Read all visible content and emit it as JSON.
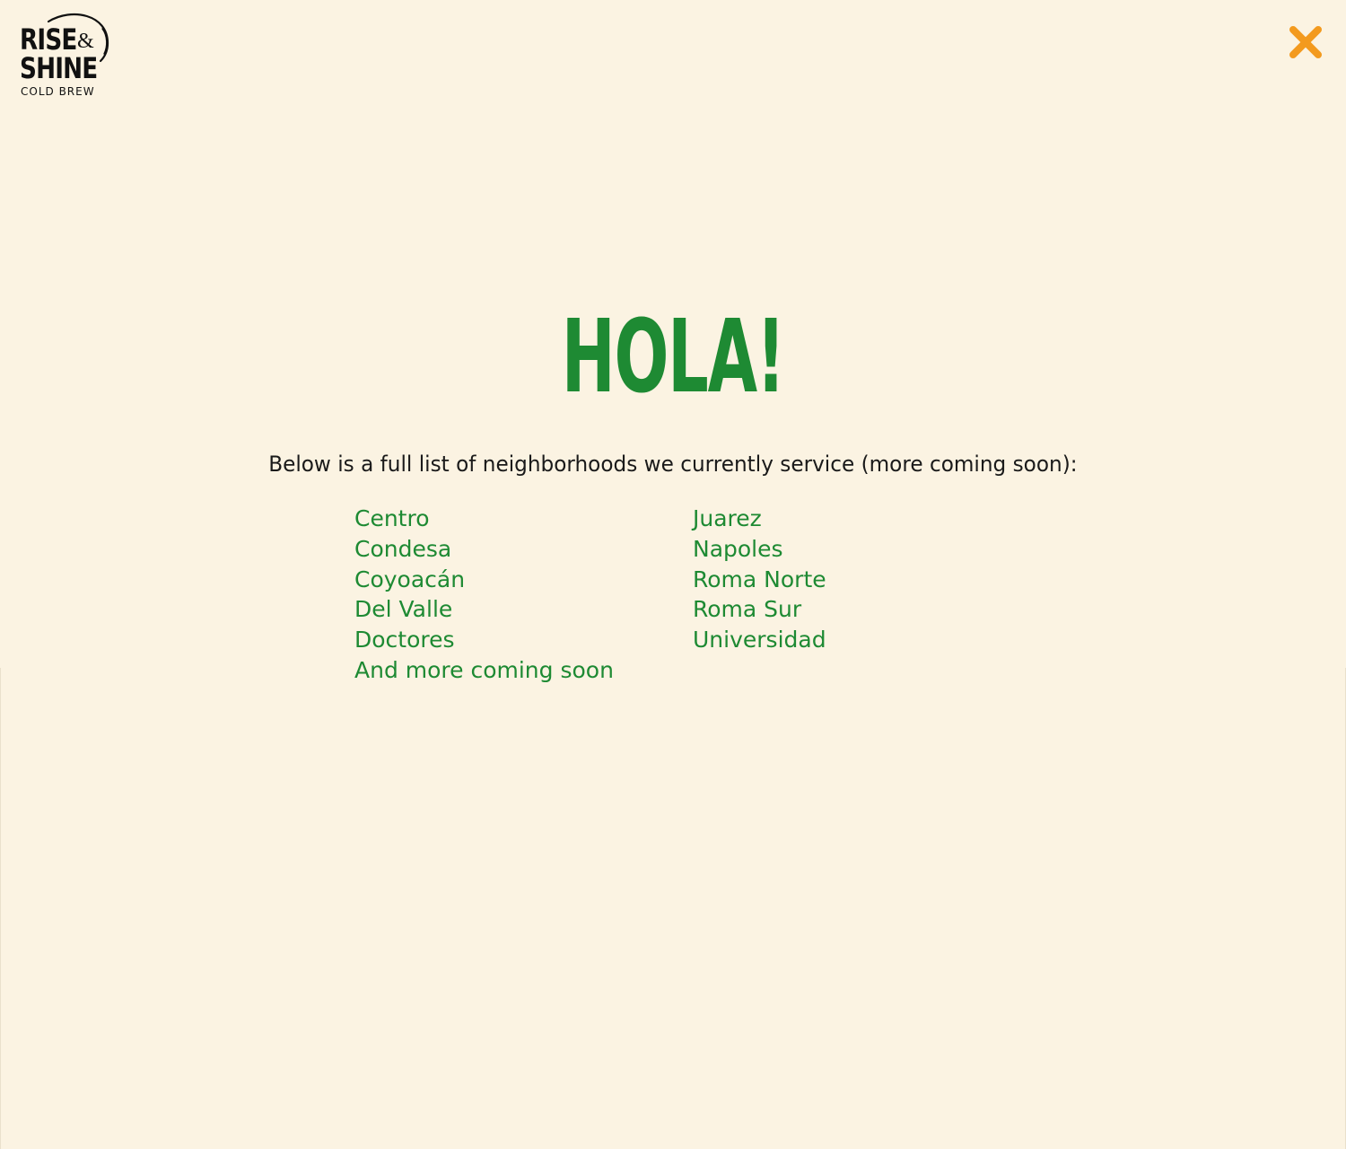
{
  "brand": {
    "line1": "RISE",
    "amp": "&",
    "line2": "SHINE",
    "tagline": "COLD BREW"
  },
  "close_button": {
    "icon": "close-icon",
    "color": "#F39A1E"
  },
  "modal": {
    "heading": "HOLA!",
    "intro": "Below is a full list of neighborhoods we currently service (more coming soon):",
    "neighborhoods_left": [
      "Centro",
      "Condesa",
      "Coyoacán",
      "Del Valle",
      "Doctores",
      "And more coming soon"
    ],
    "neighborhoods_right": [
      "Juarez",
      "Napoles",
      "Roma Norte",
      "Roma Sur",
      "Universidad"
    ]
  },
  "colors": {
    "background": "#FBF3E2",
    "accent_green": "#1E8A33",
    "close_orange": "#F39A1E",
    "text": "#1A1A1A"
  }
}
